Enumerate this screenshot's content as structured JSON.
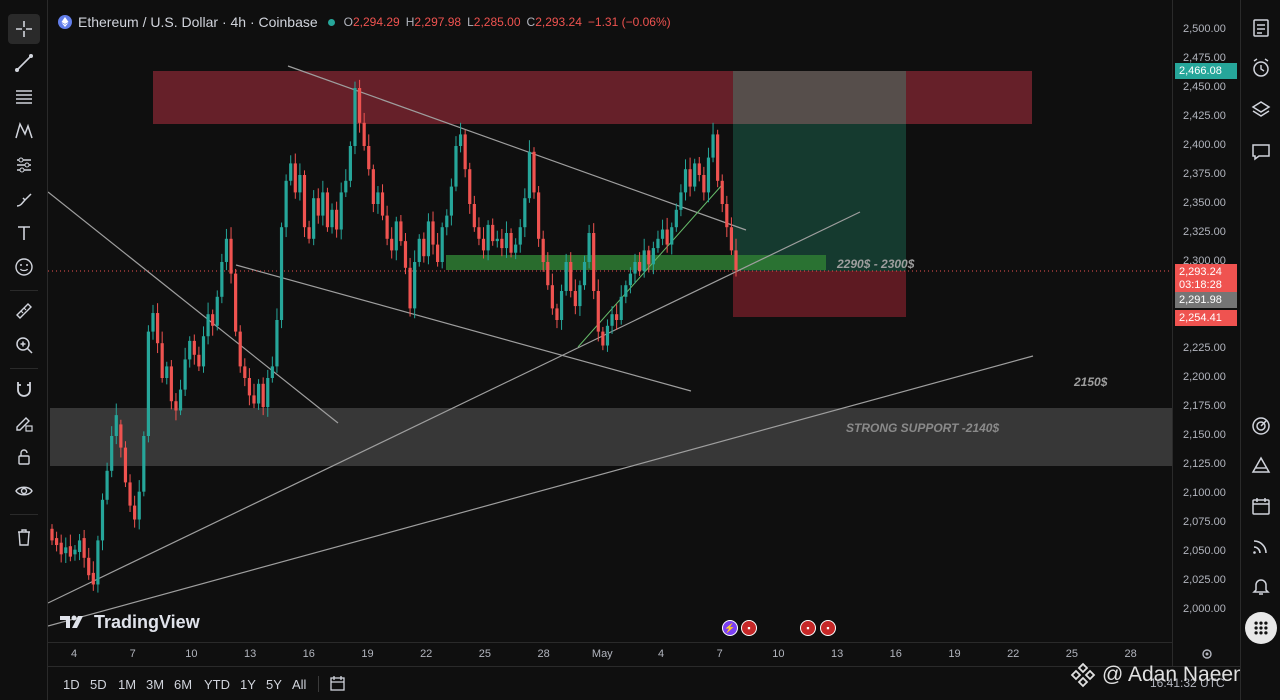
{
  "header": {
    "symbol": "Ethereum / U.S. Dollar · 4h · Coinbase",
    "o_label": "O",
    "o_value": "2,294.29",
    "h_label": "H",
    "h_value": "2,297.98",
    "l_label": "L",
    "l_value": "2,285.00",
    "c_label": "C",
    "c_value": "2,293.24",
    "change": "−1.31 (−0.06%)"
  },
  "y_axis": {
    "ticks": [
      "2,500.00",
      "2,475.00",
      "2,450.00",
      "2,425.00",
      "2,400.00",
      "2,375.00",
      "2,350.00",
      "2,325.00",
      "2,300.00",
      "2,275.00",
      "2,250.00",
      "2,225.00",
      "2,200.00",
      "2,175.00",
      "2,150.00",
      "2,125.00",
      "2,100.00",
      "2,075.00",
      "2,050.00",
      "2,025.00",
      "2,000.00"
    ],
    "price_labels": {
      "target": "2,466.08",
      "last": "2,293.24",
      "countdown": "03:18:28",
      "prev": "2,291.98",
      "stop": "2,254.41"
    }
  },
  "x_axis": {
    "ticks": [
      "4",
      "7",
      "10",
      "13",
      "16",
      "19",
      "22",
      "25",
      "28",
      "May",
      "4",
      "7",
      "10",
      "13",
      "16",
      "19",
      "22",
      "25",
      "28"
    ]
  },
  "annotations": {
    "zone_label": "2290$ - 2300$",
    "level_label": "2150$",
    "support_label": "STRONG SUPPORT -2140$"
  },
  "watermark": "TradingView",
  "ranges": [
    "1D",
    "5D",
    "1M",
    "3M",
    "6M",
    "YTD",
    "1Y",
    "5Y",
    "All"
  ],
  "credit": "@ Adan Naeem",
  "clock": "16:41:32 UTC",
  "colors": {
    "bull": "#26a69a",
    "bear": "#ef5350",
    "resistance_zone": "#7a2530",
    "target_zone": "#1b5e4a",
    "stop_zone": "#6b1c26",
    "entry_zone": "#2e7d32",
    "support_zone": "#5a5a5a"
  },
  "icons": {
    "left_toolbar": [
      "crosshair-icon",
      "trendline-icon",
      "fib-retracement-icon",
      "pattern-icon",
      "forecast-icon",
      "brush-icon",
      "text-icon",
      "emoji-icon",
      "ruler-icon",
      "zoom-in-icon",
      "magnet-icon",
      "lock-drawing-icon",
      "lock-icon",
      "eye-icon",
      "trash-icon"
    ],
    "right_toolbar": [
      "watchlist-icon",
      "alerts-icon",
      "layers-icon",
      "chat-icon",
      "target-icon",
      "triangle-icon",
      "calendar-icon",
      "signal-icon",
      "bell-icon",
      "apps-icon"
    ]
  }
}
